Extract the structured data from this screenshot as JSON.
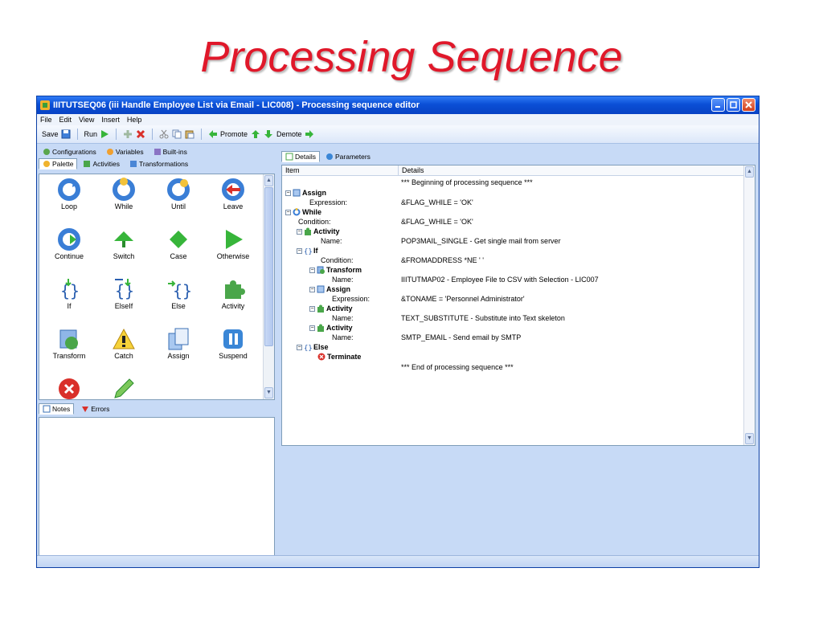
{
  "slide": {
    "title": "Processing Sequence"
  },
  "window": {
    "title": "IIITUTSEQ06 (iii Handle Employee List via Email - LIC008) - Processing sequence editor"
  },
  "menu": [
    "File",
    "Edit",
    "View",
    "Insert",
    "Help"
  ],
  "toolbar": {
    "save": "Save",
    "run": "Run",
    "promote": "Promote",
    "demote": "Demote"
  },
  "left_tabs": {
    "configurations": "Configurations",
    "variables": "Variables",
    "builtins": "Built-ins",
    "palette": "Palette",
    "activities": "Activities",
    "transformations": "Transformations"
  },
  "palette": [
    {
      "label": "Loop",
      "icon": "loop-icon"
    },
    {
      "label": "While",
      "icon": "while-icon"
    },
    {
      "label": "Until",
      "icon": "until-icon"
    },
    {
      "label": "Leave",
      "icon": "leave-icon"
    },
    {
      "label": "Continue",
      "icon": "continue-icon"
    },
    {
      "label": "Switch",
      "icon": "switch-icon"
    },
    {
      "label": "Case",
      "icon": "case-icon"
    },
    {
      "label": "Otherwise",
      "icon": "otherwise-icon"
    },
    {
      "label": "If",
      "icon": "if-icon"
    },
    {
      "label": "ElseIf",
      "icon": "elseif-icon"
    },
    {
      "label": "Else",
      "icon": "else-icon"
    },
    {
      "label": "Activity",
      "icon": "activity-icon"
    },
    {
      "label": "Transform",
      "icon": "transform-icon"
    },
    {
      "label": "Catch",
      "icon": "catch-icon"
    },
    {
      "label": "Assign",
      "icon": "assign-icon"
    },
    {
      "label": "Suspend",
      "icon": "suspend-icon"
    },
    {
      "label": "",
      "icon": "terminate-icon"
    },
    {
      "label": "",
      "icon": "pencil-icon"
    }
  ],
  "notes_tabs": {
    "notes": "Notes",
    "errors": "Errors"
  },
  "right_tabs": {
    "details": "Details",
    "parameters": "Parameters"
  },
  "grid": {
    "headers": {
      "item": "Item",
      "details": "Details"
    },
    "rows": [
      {
        "item": "",
        "detail": "*** Beginning of processing sequence ***"
      },
      {
        "item": "Assign",
        "bold": true,
        "detail": ""
      },
      {
        "item": "Expression:",
        "detail": "&FLAG_WHILE = 'OK'"
      },
      {
        "item": "While",
        "bold": true,
        "detail": ""
      },
      {
        "item": "Condition:",
        "detail": "&FLAG_WHILE = 'OK'"
      },
      {
        "item": "Activity",
        "bold": true,
        "detail": ""
      },
      {
        "item": "Name:",
        "detail": "POP3MAIL_SINGLE - Get single mail from server"
      },
      {
        "item": "If",
        "bold": true,
        "detail": ""
      },
      {
        "item": "Condition:",
        "detail": "&FROMADDRESS *NE ' '"
      },
      {
        "item": "Transform",
        "bold": true,
        "detail": ""
      },
      {
        "item": "Name:",
        "detail": "IIITUTMAP02 - Employee File to CSV with Selection - LIC007"
      },
      {
        "item": "Assign",
        "bold": true,
        "detail": ""
      },
      {
        "item": "Expression:",
        "detail": "&TONAME = 'Personnel Administrator'"
      },
      {
        "item": "Activity",
        "bold": true,
        "detail": ""
      },
      {
        "item": "Name:",
        "detail": "TEXT_SUBSTITUTE - Substitute into Text skeleton"
      },
      {
        "item": "Activity",
        "bold": true,
        "detail": ""
      },
      {
        "item": "Name:",
        "detail": "SMTP_EMAIL - Send email by SMTP"
      },
      {
        "item": "Else",
        "bold": true,
        "detail": ""
      },
      {
        "item": "Terminate",
        "bold": true,
        "detail": ""
      },
      {
        "item": "",
        "detail": "*** End of processing sequence ***"
      }
    ]
  },
  "colors": {
    "title_red": "#e0182a",
    "titlebar_blue": "#0a4fd6",
    "panel_bg": "#c7daf6"
  }
}
